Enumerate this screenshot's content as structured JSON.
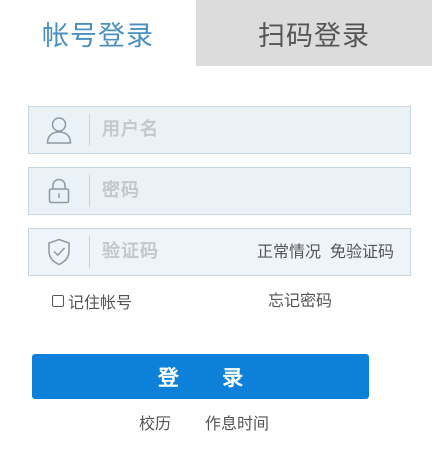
{
  "tabs": {
    "account_login": "帐号登录",
    "qr_login": "扫码登录"
  },
  "form": {
    "username_placeholder": "用户名",
    "password_placeholder": "密码",
    "captcha_placeholder": "验证码",
    "captcha_option_normal": "正常情况",
    "captcha_option_free": "免验证码",
    "remember_label": "记住帐号",
    "forgot_password": "忘记密码",
    "login_button": "登 录"
  },
  "footer": {
    "link_calendar": "校历",
    "link_schedule": "作息时间"
  },
  "icons": {
    "username": "user-icon",
    "password": "lock-icon",
    "captcha": "shield-check-icon"
  },
  "colors": {
    "active_tab_text": "#4a90c2",
    "inactive_tab_bg": "#dcdcdc",
    "field_bg": "#eaf2f8",
    "login_button_bg": "#0d80d9"
  }
}
